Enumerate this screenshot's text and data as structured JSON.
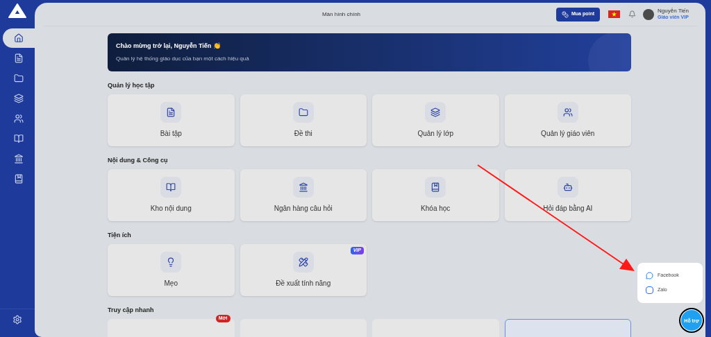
{
  "header": {
    "title": "Màn hình chính",
    "buy_button": "Mua point",
    "user": {
      "name": "Nguyễn Tiến",
      "role": "Giáo viên VIP"
    }
  },
  "sidebar": {
    "items": [
      {
        "selected": true
      },
      {
        "selected": false
      },
      {
        "selected": false
      },
      {
        "selected": false
      },
      {
        "selected": false
      },
      {
        "selected": false
      },
      {
        "selected": false
      },
      {
        "selected": false
      }
    ]
  },
  "banner": {
    "title": "Chào mừng trở lại, Nguyễn Tiến 👏",
    "subtitle": "Quản lý hệ thống giáo dục của bạn một cách hiệu quả"
  },
  "sections": [
    {
      "title": "Quản lý học tập",
      "cards": [
        {
          "label": "Bài tập"
        },
        {
          "label": "Đề thi"
        },
        {
          "label": "Quản lý lớp"
        },
        {
          "label": "Quản lý giáo viên"
        }
      ]
    },
    {
      "title": "Nội dung & Công cụ",
      "cards": [
        {
          "label": "Kho nội dung"
        },
        {
          "label": "Ngân hàng câu hỏi"
        },
        {
          "label": "Khóa học"
        },
        {
          "label": "Hỏi đáp bằng AI"
        }
      ]
    },
    {
      "title": "Tiện ích",
      "cards": [
        {
          "label": "Mẹo"
        },
        {
          "label": "Đề xuất tính năng",
          "badge": "VIP"
        }
      ]
    }
  ],
  "quick_access": {
    "title": "Truy cập nhanh",
    "cards": [
      {
        "badge": "Mới",
        "highlighted": false
      },
      {
        "highlighted": false
      },
      {
        "highlighted": false
      },
      {
        "highlighted": true
      }
    ]
  },
  "support_popup": {
    "items": [
      "Facebook",
      "Zalo"
    ],
    "button": "Hỗ trợ"
  }
}
